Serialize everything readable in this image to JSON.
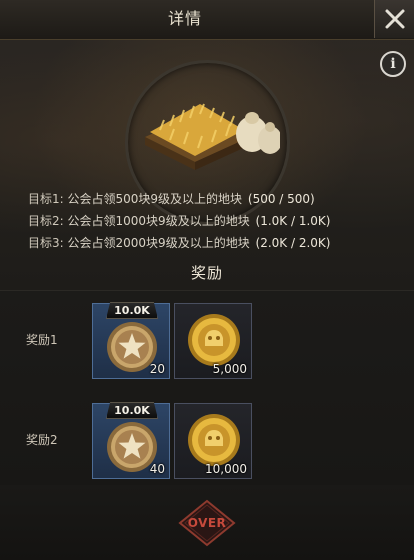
{
  "header": {
    "title": "详情"
  },
  "goals": [
    {
      "label": "目标1:",
      "text": "公会占领500块9级及以上的地块",
      "progress": "(500 / 500)"
    },
    {
      "label": "目标2:",
      "text": "公会占领1000块9级及以上的地块",
      "progress": "(1.0K / 1.0K)"
    },
    {
      "label": "目标3:",
      "text": "公会占领2000块9级及以上的地块",
      "progress": "(2.0K / 2.0K)"
    }
  ],
  "rewards": {
    "title": "奖励",
    "rows": [
      {
        "label": "奖励1",
        "items": [
          {
            "icon": "medal-icon",
            "tag": "10.0K",
            "count": "20"
          },
          {
            "icon": "gold-coin-icon",
            "count": "5,000"
          }
        ]
      },
      {
        "label": "奖励2",
        "items": [
          {
            "icon": "medal-icon",
            "tag": "10.0K",
            "count": "40"
          },
          {
            "icon": "gold-coin-icon",
            "count": "10,000"
          }
        ]
      }
    ]
  },
  "footer": {
    "status": "OVER"
  },
  "colors": {
    "accent_gold": "#d8a638",
    "status_red": "#c64a3c",
    "slot_blue": "#2d4566"
  }
}
